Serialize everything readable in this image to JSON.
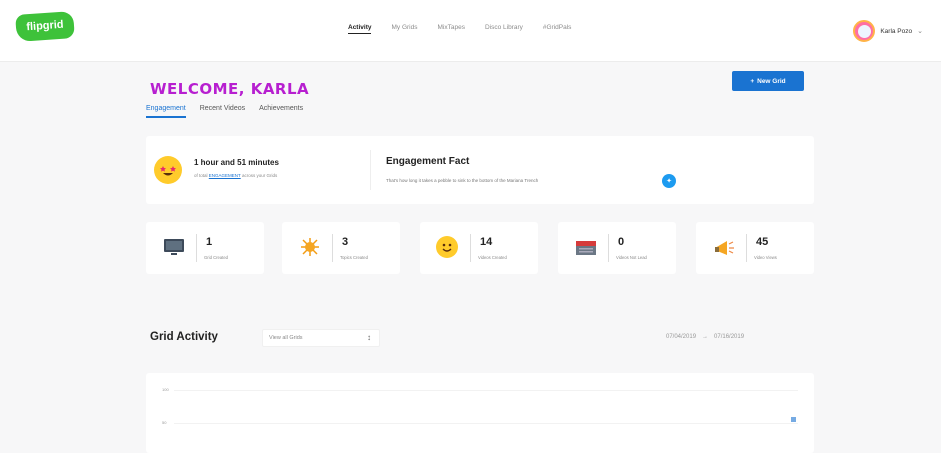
{
  "brand": {
    "logo_text": "flipgrid"
  },
  "nav": {
    "items": [
      "Activity",
      "My Grids",
      "MixTapes",
      "Disco Library",
      "#GridPals"
    ]
  },
  "profile": {
    "name": "Karla Pozo"
  },
  "welcome": {
    "title": "WELCOME, KARLA",
    "new_grid_label": "New Grid"
  },
  "tabs": [
    "Engagement",
    "Recent Videos",
    "Achievements"
  ],
  "engagement": {
    "time": "1 hour and 51 minutes",
    "time_sub_prefix": "of total",
    "time_sub_link": "ENGAGEMENT",
    "time_sub_suffix": "across your Grids",
    "fact_title": "Engagement Fact",
    "fact_text": "That's how long it takes a pebble to sink to the bottom of the Mariana Trench"
  },
  "stats": [
    {
      "value": "1",
      "label": "Grid Created",
      "icon": "tv-icon"
    },
    {
      "value": "3",
      "label": "Topics Created",
      "icon": "sun-icon"
    },
    {
      "value": "14",
      "label": "Videos Created",
      "icon": "smile-icon"
    },
    {
      "value": "0",
      "label": "Videos Not Lead",
      "icon": "calendar-icon"
    },
    {
      "value": "45",
      "label": "Video Views",
      "icon": "megaphone-icon"
    }
  ],
  "grid_activity": {
    "title": "Grid Activity",
    "filter_value": "View all Grids",
    "date_start": "07/04/2019",
    "date_sep": "→",
    "date_end": "07/16/2019",
    "y_top": "100",
    "y_mid": "50"
  },
  "colors": {
    "accent": "#1a73d1",
    "brand": "#3ec23a",
    "welcome": "#b71fd0"
  }
}
